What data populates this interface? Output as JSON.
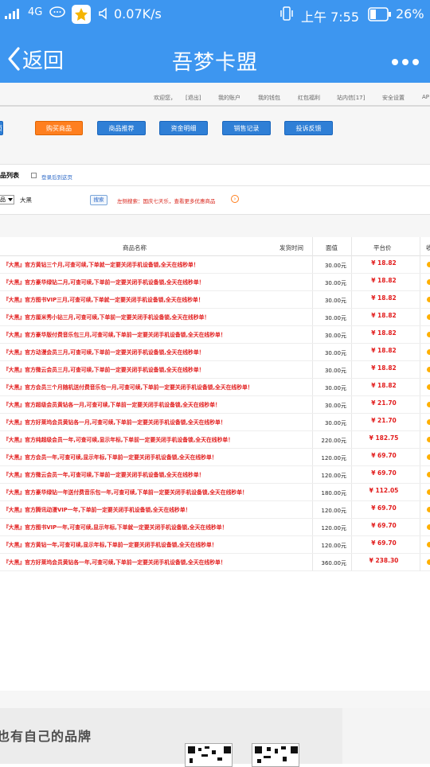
{
  "status_bar": {
    "network": "4G",
    "speed": "0.07K/s",
    "time": "上午 7:55",
    "battery": "26%"
  },
  "nav": {
    "back_label": "返回",
    "title": "吾梦卡盟"
  },
  "top_links": [
    "欢迎您，",
    "[退出]",
    "我的账户",
    "我的钱包",
    "红包福利",
    "站内信[17]",
    "安全设置",
    "AP"
  ],
  "buttons": [
    {
      "label": "页"
    },
    {
      "label": "购买商品"
    },
    {
      "label": "商品推荐"
    },
    {
      "label": "资金明细"
    },
    {
      "label": "销售记录"
    },
    {
      "label": "投诉反馈"
    }
  ],
  "list": {
    "title": "品列表",
    "checkbox_label": "登录后到这页"
  },
  "search": {
    "select_value": "品",
    "keyword": "大黑",
    "button_label": "搜索",
    "tip": "左侧搜索：国庆七天乐，查看更多优惠商品"
  },
  "table": {
    "headers": [
      "商品名称",
      "发货时间",
      "面值",
      "平台价",
      "收"
    ],
    "rows": [
      {
        "name": "『大黑』官方黄钻三个月,可查可续,下单就一定要关闭手机设备锁,全天在线秒单！",
        "face": "30.00元",
        "price": "¥ 18.82"
      },
      {
        "name": "『大黑』官方豪华绿钻二月,可查可续,下单前一定要关闭手机设备锁,全天在线秒单！",
        "face": "30.00元",
        "price": "¥ 18.82"
      },
      {
        "name": "『大黑』官方图书VIP三月,可查可续,下单就一定要关闭手机设备锁,全天在线秒单！",
        "face": "30.00元",
        "price": "¥ 18.82"
      },
      {
        "name": "『大黑』官方厘米秀小钻三月,可查可续,下单前一定要关闭手机设备锁,全天在线秒单！",
        "face": "30.00元",
        "price": "¥ 18.82"
      },
      {
        "name": "『大黑』官方豪华版付费音乐包三月,可查可续,下单前一定要关闭手机设备锁,全天在线秒单！",
        "face": "30.00元",
        "price": "¥ 18.82"
      },
      {
        "name": "『大黑』官方动漫会员三月,可查可续,下单前一定要关闭手机设备锁,全天在线秒单！",
        "face": "30.00元",
        "price": "¥ 18.82"
      },
      {
        "name": "『大黑』官方微云会员三月,可查可续,下单前一定要关闭手机设备锁,全天在线秒单！",
        "face": "30.00元",
        "price": "¥ 18.82"
      },
      {
        "name": "『大黑』官方会员三个月随机送付费音乐包一月,可查可续,下单前一定要关闭手机设备锁,全天在线秒单！",
        "face": "30.00元",
        "price": "¥ 18.82"
      },
      {
        "name": "『大黑』官方超级会员黄钻各一月,可查可续,下单前一定要关闭手机设备锁,全天在线秒单！",
        "face": "30.00元",
        "price": "¥ 21.70"
      },
      {
        "name": "『大黑』官方好莱坞会员黄钻各一月,可查可续,下单前一定要关闭手机设备锁,全天在线秒单！",
        "face": "30.00元",
        "price": "¥ 21.70"
      },
      {
        "name": "『大黑』官方纯超级会员一年,可查可续,显示年标,下单前一定要关闭手机设备锁,全天在线秒单！",
        "face": "220.00元",
        "price": "¥ 182.75"
      },
      {
        "name": "『大黑』官方会员一年,可查可续,显示年标,下单前一定要关闭手机设备锁,全天在线秒单！",
        "face": "120.00元",
        "price": "¥ 69.70"
      },
      {
        "name": "『大黑』官方微云会员一年,可查可续,下单前一定要关闭手机设备锁,全天在线秒单！",
        "face": "120.00元",
        "price": "¥ 69.70"
      },
      {
        "name": "『大黑』官方豪华绿钻一年送付费音乐包一年,可查可续,下单前一定要关闭手机设备锁,全天在线秒单！",
        "face": "180.00元",
        "price": "¥ 112.05"
      },
      {
        "name": "『大黑』官方腾讯动漫VIP一年,下单前一定要关闭手机设备锁,全天在线秒单！",
        "face": "120.00元",
        "price": "¥ 69.70"
      },
      {
        "name": "『大黑』官方图书VIP一年,可查可续,显示年标,下单就一定要关闭手机设备锁,全天在线秒单！",
        "face": "120.00元",
        "price": "¥ 69.70"
      },
      {
        "name": "『大黑』官方黄钻一年,可查可续,显示年标,下单前一定要关闭手机设备锁,全天在线秒单！",
        "face": "120.00元",
        "price": "¥ 69.70"
      },
      {
        "name": "『大黑』官方好莱坞会员黄钻各一年,可查可续,下单前一定要关闭手机设备锁,全天在线秒单！",
        "face": "360.00元",
        "price": "¥ 238.30"
      }
    ]
  },
  "footer": {
    "brand": "也有自己的品牌"
  },
  "colors": {
    "nav_blue": "#3d96f0",
    "button_blue": "#2f7fd6",
    "button_orange": "#ff7f1f",
    "price_red": "#e21d1d"
  }
}
